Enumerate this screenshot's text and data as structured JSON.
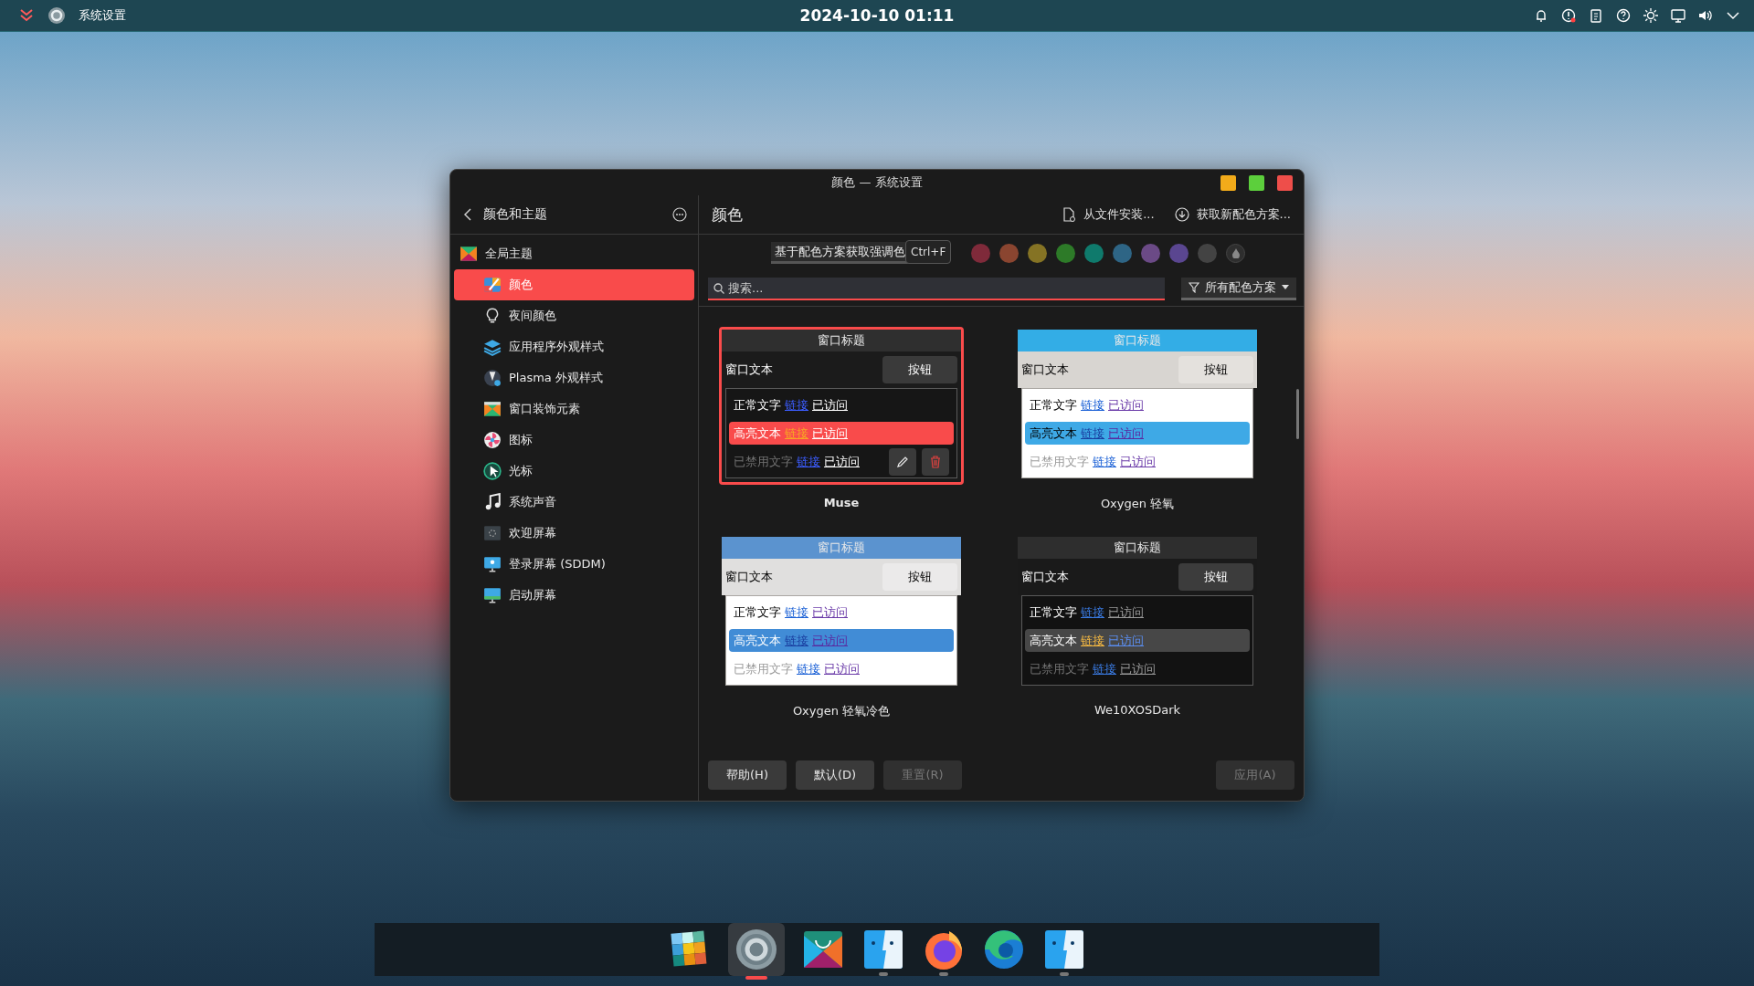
{
  "top_bar": {
    "app_title": "系统设置",
    "clock": "2024-10-10 01:11",
    "tray": [
      {
        "kind": "bell"
      },
      {
        "kind": "alert"
      },
      {
        "kind": "clipboard"
      },
      {
        "kind": "help"
      },
      {
        "kind": "brightness"
      },
      {
        "kind": "display"
      },
      {
        "kind": "volume"
      },
      {
        "kind": "expand"
      }
    ]
  },
  "window": {
    "title": "颜色 — 系统设置"
  },
  "sidebar": {
    "title": "颜色和主题",
    "items": [
      {
        "label": "全局主题",
        "kind": "global-theme",
        "selected": false,
        "children": [
          {
            "label": "颜色",
            "kind": "colors",
            "selected": true
          },
          {
            "label": "夜间颜色",
            "kind": "bulb",
            "selected": false
          },
          {
            "label": "应用程序外观样式",
            "kind": "app-style",
            "selected": false
          },
          {
            "label": "Plasma 外观样式",
            "kind": "plasma",
            "selected": false
          },
          {
            "label": "窗口装饰元素",
            "kind": "decorations",
            "selected": false
          },
          {
            "label": "图标",
            "kind": "icons",
            "selected": false
          },
          {
            "label": "光标",
            "kind": "cursor",
            "selected": false
          },
          {
            "label": "系统声音",
            "kind": "sound",
            "selected": false
          },
          {
            "label": "欢迎屏幕",
            "kind": "splash",
            "selected": false
          },
          {
            "label": "登录屏幕 (SDDM)",
            "kind": "login",
            "selected": false
          },
          {
            "label": "启动屏幕",
            "kind": "boot",
            "selected": false
          }
        ]
      }
    ]
  },
  "page": {
    "title": "颜色",
    "actions": [
      {
        "label": "从文件安装...",
        "kind": "file"
      },
      {
        "label": "获取新配色方案...",
        "kind": "download"
      }
    ]
  },
  "accent": {
    "label": "基于配色方案获取强调色",
    "tooltip": "Ctrl+F",
    "swatches": [
      {
        "kind": "color",
        "color": "#7f2a3a",
        "selected": false
      },
      {
        "kind": "color",
        "color": "#8a4530",
        "selected": false
      },
      {
        "kind": "color",
        "color": "#857324",
        "selected": false
      },
      {
        "kind": "color",
        "color": "#2d7a28",
        "selected": false
      },
      {
        "kind": "color",
        "color": "#0f7a6c",
        "selected": false
      },
      {
        "kind": "color",
        "color": "#2e6585",
        "selected": false
      },
      {
        "kind": "color",
        "color": "#6b4a86",
        "selected": false
      },
      {
        "kind": "color",
        "color": "#5a4690",
        "selected": false
      },
      {
        "kind": "color",
        "color": "#434343",
        "selected": false
      },
      {
        "kind": "custom",
        "selected": false
      }
    ]
  },
  "search": {
    "placeholder": "搜索...",
    "focused": true
  },
  "filter": {
    "label": "所有配色方案"
  },
  "schemes": [
    {
      "name": "Muse",
      "selected": true,
      "titlebar": {
        "label": "窗口标题",
        "color": "#2f2f2f"
      },
      "window": {
        "label": "窗口文本",
        "color": "#1b1b1b"
      },
      "button": {
        "label": "按钮",
        "color": "#3a3a3a"
      },
      "view": {
        "color": "#161616"
      },
      "rows": [
        {
          "kind": "normal",
          "text": "正常文字",
          "link": {
            "label": "链接",
            "color": "#3c5dff"
          },
          "visited": {
            "label": "已访问",
            "color": "#ffffff"
          }
        },
        {
          "kind": "highlight",
          "color": "#f94b4b",
          "text": "高亮文本",
          "link": {
            "label": "链接",
            "color": "#f7a823"
          },
          "visited": {
            "label": "已访问",
            "color": "#ffffff"
          }
        },
        {
          "kind": "disabled",
          "text": "已禁用文字",
          "link": {
            "label": "链接",
            "color": "#3c5dff"
          },
          "visited": {
            "label": "已访问",
            "color": "#ffffff"
          }
        }
      ]
    },
    {
      "name": "Oxygen 轻氧",
      "selected": false,
      "titlebar": {
        "label": "窗口标题",
        "color": "#33ade6"
      },
      "window": {
        "label": "窗口文本",
        "color": "#d8d5d1"
      },
      "button": {
        "label": "按钮",
        "color": "#e4e1dd"
      },
      "view": {
        "color": "#ffffff"
      },
      "rows": [
        {
          "kind": "normal",
          "text": "正常文字",
          "link": {
            "label": "链接",
            "color": "#1d62d6"
          },
          "visited": {
            "label": "已访问",
            "color": "#6a3aa8"
          }
        },
        {
          "kind": "highlight",
          "color": "#3ea9e6",
          "text": "高亮文本",
          "link": {
            "label": "链接",
            "color": "#1a3fa0"
          },
          "visited": {
            "label": "已访问",
            "color": "#5a2aa0"
          }
        },
        {
          "kind": "disabled",
          "text": "已禁用文字",
          "link": {
            "label": "链接",
            "color": "#1d62d6"
          },
          "visited": {
            "label": "已访问",
            "color": "#6a3aa8"
          }
        }
      ]
    },
    {
      "name": "Oxygen 轻氧冷色",
      "selected": false,
      "titlebar": {
        "label": "窗口标题",
        "color": "#5b93cf"
      },
      "window": {
        "label": "窗口文本",
        "color": "#e0dfde"
      },
      "button": {
        "label": "按钮",
        "color": "#ebeaea"
      },
      "view": {
        "color": "#ffffff"
      },
      "rows": [
        {
          "kind": "normal",
          "text": "正常文字",
          "link": {
            "label": "链接",
            "color": "#1d62d6"
          },
          "visited": {
            "label": "已访问",
            "color": "#6a3aa8"
          }
        },
        {
          "kind": "highlight",
          "color": "#418cd6",
          "text": "高亮文本",
          "link": {
            "label": "链接",
            "color": "#1a3fa0"
          },
          "visited": {
            "label": "已访问",
            "color": "#5a2aa0"
          }
        },
        {
          "kind": "disabled",
          "text": "已禁用文字",
          "link": {
            "label": "链接",
            "color": "#1d62d6"
          },
          "visited": {
            "label": "已访问",
            "color": "#6a3aa8"
          }
        }
      ]
    },
    {
      "name": "We10XOSDark",
      "selected": false,
      "titlebar": {
        "label": "窗口标题",
        "color": "#2e2e2e"
      },
      "window": {
        "label": "窗口文本",
        "color": "#1a1a1a"
      },
      "button": {
        "label": "按钮",
        "color": "#3c3c3c"
      },
      "view": {
        "color": "#121212"
      },
      "rows": [
        {
          "kind": "normal",
          "text": "正常文字",
          "link": {
            "label": "链接",
            "color": "#3a7ae0"
          },
          "visited": {
            "label": "已访问",
            "color": "#9a9a9a"
          }
        },
        {
          "kind": "highlight",
          "color": "#474747",
          "text": "高亮文本",
          "link": {
            "label": "链接",
            "color": "#f5b942"
          },
          "visited": {
            "label": "已访问",
            "color": "#5b8ef0"
          }
        },
        {
          "kind": "disabled",
          "text": "已禁用文字",
          "link": {
            "label": "链接",
            "color": "#3a7ae0"
          },
          "visited": {
            "label": "已访问",
            "color": "#9a9a9a"
          }
        }
      ]
    }
  ],
  "buttons": [
    {
      "label": "帮助(H)",
      "disabled": false
    },
    {
      "label": "默认(D)",
      "disabled": false
    },
    {
      "label": "重置(R)",
      "disabled": true
    },
    {
      "label": "应用(A)",
      "disabled": true
    }
  ],
  "dock": {
    "items": [
      {
        "kind": "grid",
        "active": false,
        "running": false
      },
      {
        "kind": "gear",
        "active": true,
        "running": true
      },
      {
        "kind": "bag",
        "active": false,
        "running": false
      },
      {
        "kind": "finder",
        "active": false,
        "running": true
      },
      {
        "kind": "firefox",
        "active": false,
        "running": true
      },
      {
        "kind": "edge",
        "active": false,
        "running": false
      },
      {
        "kind": "finder",
        "active": false,
        "running": true
      }
    ]
  }
}
